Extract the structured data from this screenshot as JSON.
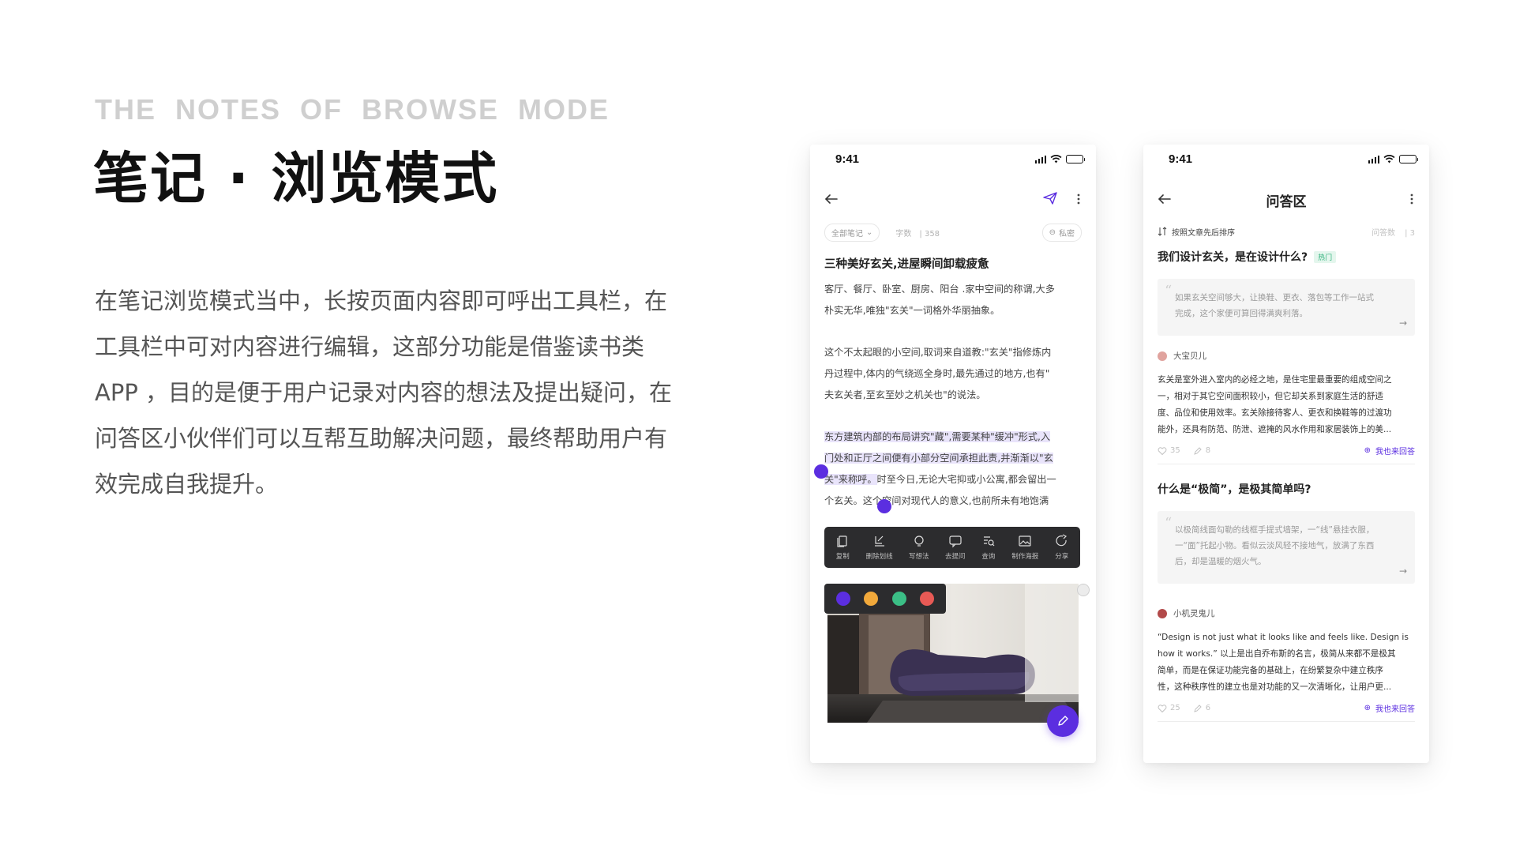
{
  "eyebrow": "THE  NOTES  OF  BROWSE  MODE",
  "title": "笔记 · 浏览模式",
  "description": [
    "在笔记浏览模式当中，长按页面内容即可呼出工具栏，在",
    "工具栏中可对内容进行编辑，这部分功能是借鉴读书类",
    "APP ，目的是便于用户记录对内容的想法及提出疑问，在",
    "问答区小伙伴们可以互帮互助解决问题，最终帮助用户有",
    "效完成自我提升。"
  ],
  "note_phone": {
    "time": "9:41",
    "filter_label": "全部笔记",
    "word_count_label": "字数",
    "word_count": "358",
    "privacy_label": "私密",
    "article_title": "三种美好玄关,进屋瞬间卸载疲惫",
    "para1": [
      "客厅、餐厅、卧室、厨房、阳台 .家中空间的称谓,大多",
      "朴实无华,唯独\"玄关\"一词格外华丽抽象。"
    ],
    "para2": [
      "这个不太起眼的小空间,取词来自道教:\"玄关\"指修炼内",
      "丹过程中,体内的气绕巡全身时,最先通过的地方,也有\"",
      "夫玄关者,至玄至妙之机关也\"的说法。"
    ],
    "para3_highlight": [
      "东方建筑内部的布局讲究\"藏\",需要某种\"缓冲\"形式,入",
      "门处和正厅之间便有小部分空间承担此责,并渐渐以\"玄",
      "关\"来称呼。"
    ],
    "para3_rest_line3": "时至今日,无论大宅抑或小公寓,都会留出一",
    "para3_line4": "个玄关。这个空间对现代人的意义,也前所未有地饱满",
    "toolbar": [
      "复制",
      "删除划线",
      "写想法",
      "去提问",
      "查询",
      "制作海报",
      "分享"
    ],
    "palette": [
      "#5b2ee0",
      "#f2a93b",
      "#3bbf86",
      "#e85a55"
    ]
  },
  "qa_phone": {
    "time": "9:41",
    "title": "问答区",
    "sort_label": "按照文章先后排序",
    "question_count_label": "问答数",
    "question_count": "3",
    "q1": {
      "title": "我们设计玄关，是在设计什么?",
      "tag": "热门",
      "quote": [
        "如果玄关空间够大，让换鞋、更衣、落包等工作一站式",
        "完成，这个家便可算回得满爽利落。"
      ],
      "user": "大宝贝儿",
      "answer": [
        "玄关是室外进入室内的必经之地，是住宅里最重要的组成空间之",
        "一，相对于其它空间面积较小，但它却关系到家庭生活的舒适",
        "度、品位和使用效率。玄关除接待客人、更衣和换鞋等的过渡功",
        "能外，还具有防范、防泄、遮掩的风水作用和家居装饰上的美..."
      ],
      "likes": "35",
      "comments": "8",
      "reply": "我也来回答"
    },
    "q2": {
      "title": "什么是“极简”，是极其简单吗?",
      "quote": [
        "以极简线面勾勒的线框手提式墙架，一“线”悬挂衣服，",
        "一“面”托起小物。看似云淡风轻不接地气，放满了东西",
        "后，却是温暖的烟火气。"
      ],
      "user": "小机灵鬼儿",
      "answer": [
        "“Design is not just what it looks like and feels like. Design is",
        "how it works.” 以上是出自乔布斯的名言，极简从来都不是极其",
        "简单，而是在保证功能完备的基础上，在纷繁复杂中建立秩序",
        "性，这种秩序性的建立也是对功能的又一次清晰化，让用户更..."
      ],
      "likes": "25",
      "comments": "6",
      "reply": "我也来回答"
    }
  }
}
